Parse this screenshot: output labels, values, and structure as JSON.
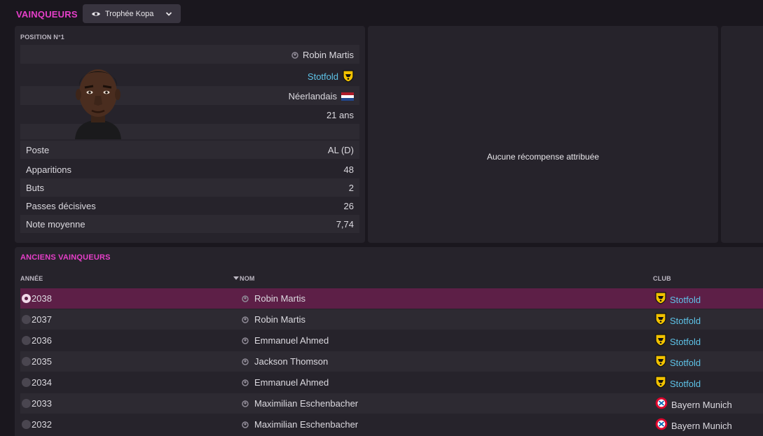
{
  "header": {
    "title": "VAINQUEURS",
    "dropdown_label": "Trophée Kopa"
  },
  "player": {
    "position_label": "POSITION N°1",
    "name": "Robin Martis",
    "club": "Stotfold",
    "nationality": "Néerlandais",
    "age": "21 ans",
    "stats": [
      {
        "label": "Poste",
        "value": "AL (D)"
      },
      {
        "label": "Apparitions",
        "value": "48"
      },
      {
        "label": "Buts",
        "value": "2"
      },
      {
        "label": "Passes décisives",
        "value": "26"
      },
      {
        "label": "Note moyenne",
        "value": "7,74"
      }
    ]
  },
  "award": {
    "empty_text": "Aucune récompense attribuée"
  },
  "history": {
    "title": "ANCIENS VAINQUEURS",
    "columns": {
      "year": "ANNÉE",
      "name": "NOM",
      "club": "CLUB"
    },
    "rows": [
      {
        "year": "2038",
        "name": "Robin Martis",
        "club": "Stotfold",
        "crest": "stotfold-crest-icon"
      },
      {
        "year": "2037",
        "name": "Robin Martis",
        "club": "Stotfold",
        "crest": "stotfold-crest-icon"
      },
      {
        "year": "2036",
        "name": "Emmanuel Ahmed",
        "club": "Stotfold",
        "crest": "stotfold-crest-icon"
      },
      {
        "year": "2035",
        "name": "Jackson Thomson",
        "club": "Stotfold",
        "crest": "stotfold-crest-icon"
      },
      {
        "year": "2034",
        "name": "Emmanuel Ahmed",
        "club": "Stotfold",
        "crest": "stotfold-crest-icon"
      },
      {
        "year": "2033",
        "name": "Maximilian Eschenbacher",
        "club": "Bayern Munich",
        "crest": "bayern-crest-icon"
      },
      {
        "year": "2032",
        "name": "Maximilian Eschenbacher",
        "club": "Bayern Munich",
        "crest": "bayern-crest-icon"
      }
    ]
  },
  "colors": {
    "accent": "#e63fc9",
    "link": "#5ec3e8",
    "selected_row": "#5d1f47",
    "panel": "#26232b",
    "background": "#1a171e"
  }
}
